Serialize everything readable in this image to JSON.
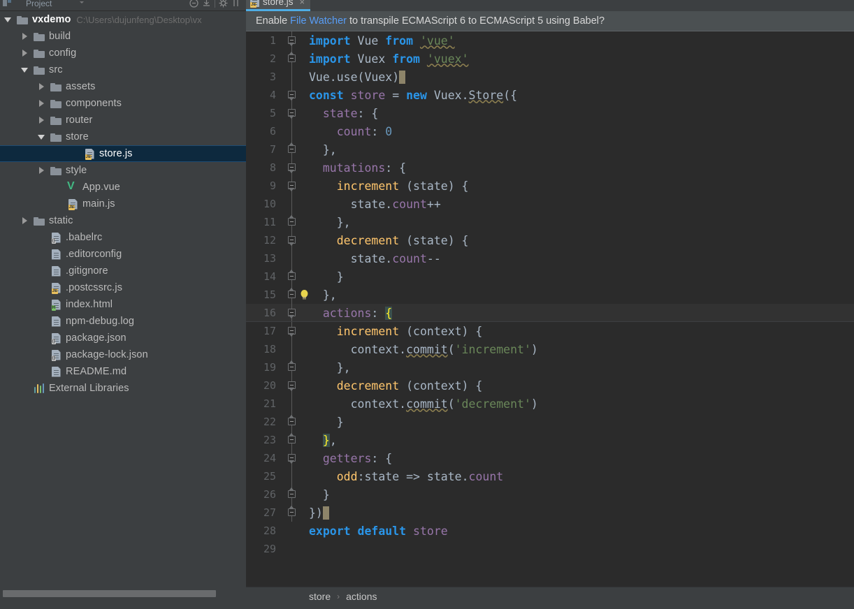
{
  "window": {
    "theme_accent": "#4eade5",
    "bg_panel": "#3c3f41",
    "bg_editor": "#2b2b2b"
  },
  "project_panel": {
    "title": "Project",
    "dropdown_icon": "chevron-down-icon",
    "toolbar_icons": [
      "collapse-all-icon",
      "expand-all-icon",
      "settings-gear-icon",
      "hide-icon"
    ],
    "tree": [
      {
        "label": "vxdemo",
        "secondary": "C:\\Users\\dujunfeng\\Desktop\\vx",
        "icon": "folder-icon",
        "twist": "expanded",
        "indent": 0,
        "bold": true,
        "selected": false
      },
      {
        "label": "build",
        "secondary": "",
        "icon": "folder-icon",
        "twist": "collapsed",
        "indent": 1,
        "bold": false,
        "selected": false
      },
      {
        "label": "config",
        "secondary": "",
        "icon": "folder-icon",
        "twist": "collapsed",
        "indent": 1,
        "bold": false,
        "selected": false
      },
      {
        "label": "src",
        "secondary": "",
        "icon": "folder-icon",
        "twist": "expanded",
        "indent": 1,
        "bold": false,
        "selected": false
      },
      {
        "label": "assets",
        "secondary": "",
        "icon": "folder-icon",
        "twist": "collapsed",
        "indent": 2,
        "bold": false,
        "selected": false
      },
      {
        "label": "components",
        "secondary": "",
        "icon": "folder-icon",
        "twist": "collapsed",
        "indent": 2,
        "bold": false,
        "selected": false
      },
      {
        "label": "router",
        "secondary": "",
        "icon": "folder-icon",
        "twist": "collapsed",
        "indent": 2,
        "bold": false,
        "selected": false
      },
      {
        "label": "store",
        "secondary": "",
        "icon": "folder-icon",
        "twist": "expanded",
        "indent": 2,
        "bold": false,
        "selected": false
      },
      {
        "label": "store.js",
        "secondary": "",
        "icon": "js-file-icon",
        "twist": "none",
        "indent": 4,
        "bold": false,
        "selected": true
      },
      {
        "label": "style",
        "secondary": "",
        "icon": "folder-icon",
        "twist": "collapsed",
        "indent": 2,
        "bold": false,
        "selected": false
      },
      {
        "label": "App.vue",
        "secondary": "",
        "icon": "vue-file-icon",
        "twist": "none",
        "indent": 3,
        "bold": false,
        "selected": false
      },
      {
        "label": "main.js",
        "secondary": "",
        "icon": "js-file-icon",
        "twist": "none",
        "indent": 3,
        "bold": false,
        "selected": false
      },
      {
        "label": "static",
        "secondary": "",
        "icon": "folder-icon",
        "twist": "collapsed",
        "indent": 1,
        "bold": false,
        "selected": false
      },
      {
        "label": ".babelrc",
        "secondary": "",
        "icon": "json-file-icon",
        "twist": "none",
        "indent": 2,
        "bold": false,
        "selected": false
      },
      {
        "label": ".editorconfig",
        "secondary": "",
        "icon": "text-file-icon",
        "twist": "none",
        "indent": 2,
        "bold": false,
        "selected": false
      },
      {
        "label": ".gitignore",
        "secondary": "",
        "icon": "text-file-icon",
        "twist": "none",
        "indent": 2,
        "bold": false,
        "selected": false
      },
      {
        "label": ".postcssrc.js",
        "secondary": "",
        "icon": "js-file-icon",
        "twist": "none",
        "indent": 2,
        "bold": false,
        "selected": false
      },
      {
        "label": "index.html",
        "secondary": "",
        "icon": "html-file-icon",
        "twist": "none",
        "indent": 2,
        "bold": false,
        "selected": false
      },
      {
        "label": "npm-debug.log",
        "secondary": "",
        "icon": "text-file-icon",
        "twist": "none",
        "indent": 2,
        "bold": false,
        "selected": false
      },
      {
        "label": "package.json",
        "secondary": "",
        "icon": "json-file-icon",
        "twist": "none",
        "indent": 2,
        "bold": false,
        "selected": false
      },
      {
        "label": "package-lock.json",
        "secondary": "",
        "icon": "json-file-icon",
        "twist": "none",
        "indent": 2,
        "bold": false,
        "selected": false
      },
      {
        "label": "README.md",
        "secondary": "",
        "icon": "text-file-icon",
        "twist": "none",
        "indent": 2,
        "bold": false,
        "selected": false
      },
      {
        "label": "External Libraries",
        "secondary": "",
        "icon": "library-icon",
        "twist": "none",
        "indent": 1,
        "bold": false,
        "selected": false
      }
    ]
  },
  "editor": {
    "tab": {
      "label": "store.js",
      "icon": "js-file-icon",
      "close_label": "×",
      "active": true
    },
    "notification": {
      "prefix": "Enable",
      "link": "File Watcher",
      "suffix": "to transpile ECMAScript 6 to ECMAScript 5 using Babel?"
    },
    "breadcrumb": {
      "items": [
        "store",
        "actions"
      ],
      "separator": "›"
    },
    "current_line": 16,
    "lines": [
      {
        "n": "1",
        "fold": "minus-down",
        "tokens": [
          {
            "t": "import",
            "c": "kw"
          },
          {
            "t": " Vue ",
            "c": "plain"
          },
          {
            "t": "from",
            "c": "kw"
          },
          {
            "t": " ",
            "c": "plain"
          },
          {
            "t": "'vue'",
            "c": "str-u"
          }
        ]
      },
      {
        "n": "2",
        "fold": "minus-up",
        "tokens": [
          {
            "t": "import",
            "c": "kw"
          },
          {
            "t": " Vuex ",
            "c": "plain"
          },
          {
            "t": "from",
            "c": "kw"
          },
          {
            "t": " ",
            "c": "plain"
          },
          {
            "t": "'vuex'",
            "c": "str-u"
          }
        ]
      },
      {
        "n": "3",
        "fold": "line",
        "tokens": [
          {
            "t": "Vue.use(Vuex)",
            "c": "plain"
          },
          {
            "t": "",
            "c": "caret"
          }
        ]
      },
      {
        "n": "4",
        "fold": "minus-down",
        "tokens": [
          {
            "t": "const",
            "c": "kw"
          },
          {
            "t": " ",
            "c": "plain"
          },
          {
            "t": "store",
            "c": "prop"
          },
          {
            "t": " = ",
            "c": "plain"
          },
          {
            "t": "new",
            "c": "kw"
          },
          {
            "t": " Vuex.",
            "c": "plain"
          },
          {
            "t": "Store",
            "c": "wavy"
          },
          {
            "t": "({",
            "c": "plain"
          }
        ]
      },
      {
        "n": "5",
        "fold": "minus-down",
        "tokens": [
          {
            "t": "  ",
            "c": "plain"
          },
          {
            "t": "state",
            "c": "prop"
          },
          {
            "t": ": {",
            "c": "plain"
          }
        ]
      },
      {
        "n": "6",
        "fold": "line",
        "tokens": [
          {
            "t": "    ",
            "c": "plain"
          },
          {
            "t": "count",
            "c": "prop"
          },
          {
            "t": ": ",
            "c": "plain"
          },
          {
            "t": "0",
            "c": "num"
          }
        ]
      },
      {
        "n": "7",
        "fold": "minus-up",
        "tokens": [
          {
            "t": "  },",
            "c": "plain"
          }
        ]
      },
      {
        "n": "8",
        "fold": "minus-down",
        "tokens": [
          {
            "t": "  ",
            "c": "plain"
          },
          {
            "t": "mutations",
            "c": "prop"
          },
          {
            "t": ": {",
            "c": "plain"
          }
        ]
      },
      {
        "n": "9",
        "fold": "minus-down",
        "tokens": [
          {
            "t": "    ",
            "c": "plain"
          },
          {
            "t": "increment",
            "c": "fn"
          },
          {
            "t": " (state) {",
            "c": "plain"
          }
        ]
      },
      {
        "n": "10",
        "fold": "line",
        "tokens": [
          {
            "t": "      state.",
            "c": "plain"
          },
          {
            "t": "count",
            "c": "prop"
          },
          {
            "t": "++",
            "c": "plain"
          }
        ]
      },
      {
        "n": "11",
        "fold": "minus-up",
        "tokens": [
          {
            "t": "    },",
            "c": "plain"
          }
        ]
      },
      {
        "n": "12",
        "fold": "minus-down",
        "tokens": [
          {
            "t": "    ",
            "c": "plain"
          },
          {
            "t": "decrement",
            "c": "fn"
          },
          {
            "t": " (state) {",
            "c": "plain"
          }
        ]
      },
      {
        "n": "13",
        "fold": "line",
        "tokens": [
          {
            "t": "      state.",
            "c": "plain"
          },
          {
            "t": "count",
            "c": "prop"
          },
          {
            "t": "--",
            "c": "plain"
          }
        ]
      },
      {
        "n": "14",
        "fold": "minus-up",
        "tokens": [
          {
            "t": "    }",
            "c": "plain"
          }
        ]
      },
      {
        "n": "15",
        "fold": "minus-up",
        "bulb": true,
        "tokens": [
          {
            "t": "  },",
            "c": "plain"
          }
        ]
      },
      {
        "n": "16",
        "fold": "minus-down",
        "current": true,
        "tokens": [
          {
            "t": "  ",
            "c": "plain"
          },
          {
            "t": "actions",
            "c": "prop"
          },
          {
            "t": ": ",
            "c": "plain"
          },
          {
            "t": "{",
            "c": "brace-hl"
          }
        ]
      },
      {
        "n": "17",
        "fold": "minus-down",
        "tokens": [
          {
            "t": "    ",
            "c": "plain"
          },
          {
            "t": "increment",
            "c": "fn"
          },
          {
            "t": " (context) {",
            "c": "plain"
          }
        ]
      },
      {
        "n": "18",
        "fold": "line",
        "tokens": [
          {
            "t": "      context.",
            "c": "plain"
          },
          {
            "t": "commit",
            "c": "wavy"
          },
          {
            "t": "(",
            "c": "plain"
          },
          {
            "t": "'increment'",
            "c": "str"
          },
          {
            "t": ")",
            "c": "plain"
          }
        ]
      },
      {
        "n": "19",
        "fold": "minus-up",
        "tokens": [
          {
            "t": "    },",
            "c": "plain"
          }
        ]
      },
      {
        "n": "20",
        "fold": "minus-down",
        "tokens": [
          {
            "t": "    ",
            "c": "plain"
          },
          {
            "t": "decrement",
            "c": "fn"
          },
          {
            "t": " (context) {",
            "c": "plain"
          }
        ]
      },
      {
        "n": "21",
        "fold": "line",
        "tokens": [
          {
            "t": "      context.",
            "c": "plain"
          },
          {
            "t": "commit",
            "c": "wavy"
          },
          {
            "t": "(",
            "c": "plain"
          },
          {
            "t": "'decrement'",
            "c": "str"
          },
          {
            "t": ")",
            "c": "plain"
          }
        ]
      },
      {
        "n": "22",
        "fold": "minus-up",
        "tokens": [
          {
            "t": "    }",
            "c": "plain"
          }
        ]
      },
      {
        "n": "23",
        "fold": "minus-up",
        "tokens": [
          {
            "t": "  ",
            "c": "plain"
          },
          {
            "t": "}",
            "c": "brace-hl"
          },
          {
            "t": ",",
            "c": "plain"
          }
        ]
      },
      {
        "n": "24",
        "fold": "minus-down",
        "tokens": [
          {
            "t": "  ",
            "c": "plain"
          },
          {
            "t": "getters",
            "c": "prop"
          },
          {
            "t": ": {",
            "c": "plain"
          }
        ]
      },
      {
        "n": "25",
        "fold": "line",
        "tokens": [
          {
            "t": "    ",
            "c": "plain"
          },
          {
            "t": "odd",
            "c": "fn"
          },
          {
            "t": ":state => state.",
            "c": "plain"
          },
          {
            "t": "count",
            "c": "prop"
          }
        ]
      },
      {
        "n": "26",
        "fold": "minus-up",
        "tokens": [
          {
            "t": "  }",
            "c": "plain"
          }
        ]
      },
      {
        "n": "27",
        "fold": "minus-up",
        "tokens": [
          {
            "t": "})",
            "c": "plain"
          },
          {
            "t": "",
            "c": "caret"
          }
        ]
      },
      {
        "n": "28",
        "fold": "none",
        "tokens": [
          {
            "t": "export",
            "c": "kw"
          },
          {
            "t": " ",
            "c": "plain"
          },
          {
            "t": "default",
            "c": "kw"
          },
          {
            "t": " ",
            "c": "plain"
          },
          {
            "t": "store",
            "c": "prop"
          }
        ]
      },
      {
        "n": "29",
        "fold": "none",
        "tokens": []
      }
    ]
  }
}
